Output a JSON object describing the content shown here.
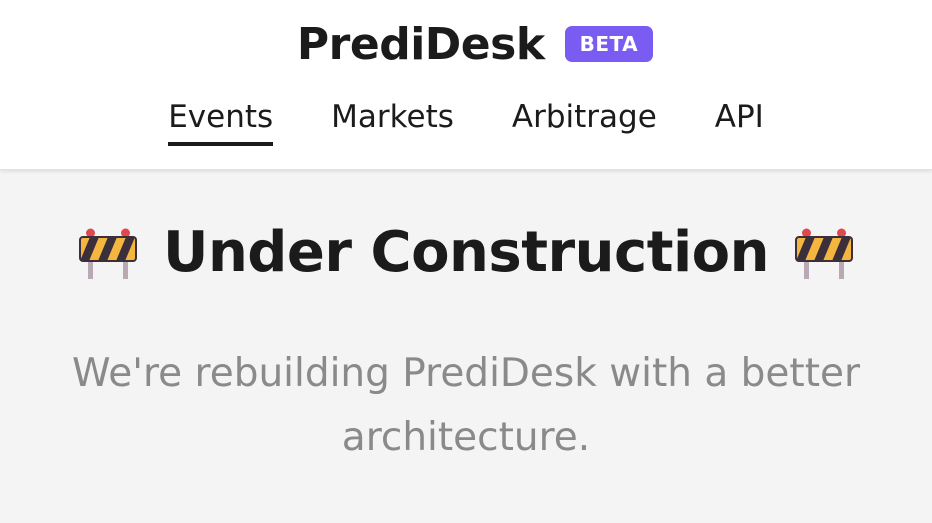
{
  "header": {
    "logo_text": "PrediDesk",
    "badge": "BETA",
    "nav": [
      {
        "label": "Events",
        "active": true
      },
      {
        "label": "Markets",
        "active": false
      },
      {
        "label": "Arbitrage",
        "active": false
      },
      {
        "label": "API",
        "active": false
      }
    ]
  },
  "main": {
    "heading": "Under Construction",
    "heading_icon": "construction-barrier-icon",
    "subtitle": "We're rebuilding PrediDesk with a better architecture."
  },
  "colors": {
    "badge_bg": "#7b5cf2",
    "text_dark": "#1b1b1b",
    "text_muted": "#8a8a8a",
    "page_bg": "#f4f4f4",
    "header_bg": "#ffffff"
  }
}
